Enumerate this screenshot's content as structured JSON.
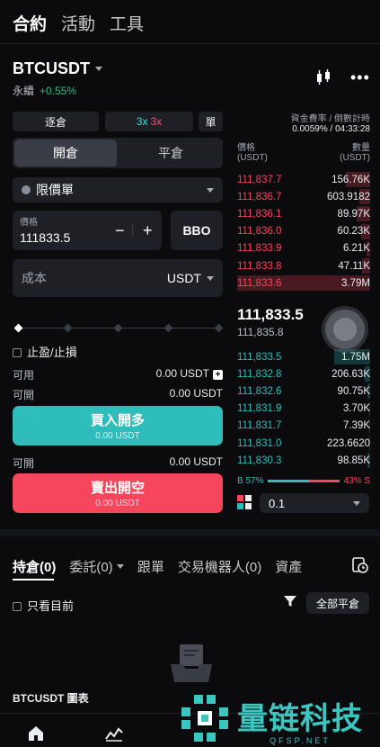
{
  "top_tabs": [
    "合約",
    "活動",
    "工具"
  ],
  "symbol": {
    "name": "BTCUSDT",
    "type": "永續",
    "change": "+0.55%"
  },
  "margin_mode": "逐倉",
  "leverage": {
    "long": "3x",
    "short": "3x"
  },
  "single_mode": "單",
  "position_tabs": {
    "open": "開倉",
    "close": "平倉"
  },
  "order_type": "限價單",
  "price": {
    "label": "價格",
    "value": "111833.5",
    "minus": "−",
    "plus": "+"
  },
  "bbo_label": "BBO",
  "cost": {
    "label": "成本",
    "unit": "USDT"
  },
  "tpsl_label": "止盈/止損",
  "available": {
    "label": "可用",
    "value": "0.00 USDT"
  },
  "openable_buy": {
    "label": "可開",
    "value": "0.00 USDT"
  },
  "buy_button": {
    "label": "買入開多",
    "sub": "0.00 USDT"
  },
  "openable_sell": {
    "label": "可開",
    "value": "0.00 USDT"
  },
  "sell_button": {
    "label": "賣出開空",
    "sub": "0.00 USDT"
  },
  "funding": {
    "label": "資金費率 / 倒數計時",
    "value": "0.0059% / 04:33:28"
  },
  "orderbook": {
    "price_header": "價格",
    "price_unit": "(USDT)",
    "qty_header": "數量",
    "qty_unit": "(USDT)",
    "asks": [
      {
        "price": "111,837.7",
        "qty": "156.76K",
        "depth": 0.18
      },
      {
        "price": "111,836.7",
        "qty": "603.9182",
        "depth": 0.08
      },
      {
        "price": "111,836.1",
        "qty": "89.97K",
        "depth": 0.1
      },
      {
        "price": "111,836.0",
        "qty": "60.23K",
        "depth": 0.07
      },
      {
        "price": "111,833.9",
        "qty": "6.21K",
        "depth": 0.03
      },
      {
        "price": "111,833.8",
        "qty": "47.11K",
        "depth": 0.06
      },
      {
        "price": "111,833.6",
        "qty": "3.79M",
        "depth": 1.0
      }
    ],
    "last_price": "111,833.5",
    "mark_price": "111,835.8",
    "bids": [
      {
        "price": "111,833.5",
        "qty": "1.75M",
        "depth": 0.27
      },
      {
        "price": "111,832.8",
        "qty": "206.63K",
        "depth": 0.04
      },
      {
        "price": "111,832.6",
        "qty": "90.75K",
        "depth": 0.02
      },
      {
        "price": "111,831.9",
        "qty": "3.70K",
        "depth": 0.01
      },
      {
        "price": "111,831.7",
        "qty": "7.39K",
        "depth": 0.01
      },
      {
        "price": "111,831.0",
        "qty": "223.6620",
        "depth": 0.01
      },
      {
        "price": "111,830.3",
        "qty": "98.85K",
        "depth": 0.02
      }
    ],
    "buy_ratio": "B 57%",
    "sell_ratio": "43% S",
    "buy_fraction": 0.57,
    "depth_value": "0.1"
  },
  "bottom_tabs": [
    "持倉(0)",
    "委託(0)",
    "跟單",
    "交易機器人(0)",
    "資產"
  ],
  "only_current": "只看目前",
  "close_all": "全部平倉",
  "chart_label": "BTCUSDT 圖表",
  "watermark": {
    "name": "量链科技",
    "url": "QFSP.NET"
  },
  "colors": {
    "buy": "#2ebdba",
    "sell": "#f6465d",
    "bg": "#0b0b0d"
  }
}
